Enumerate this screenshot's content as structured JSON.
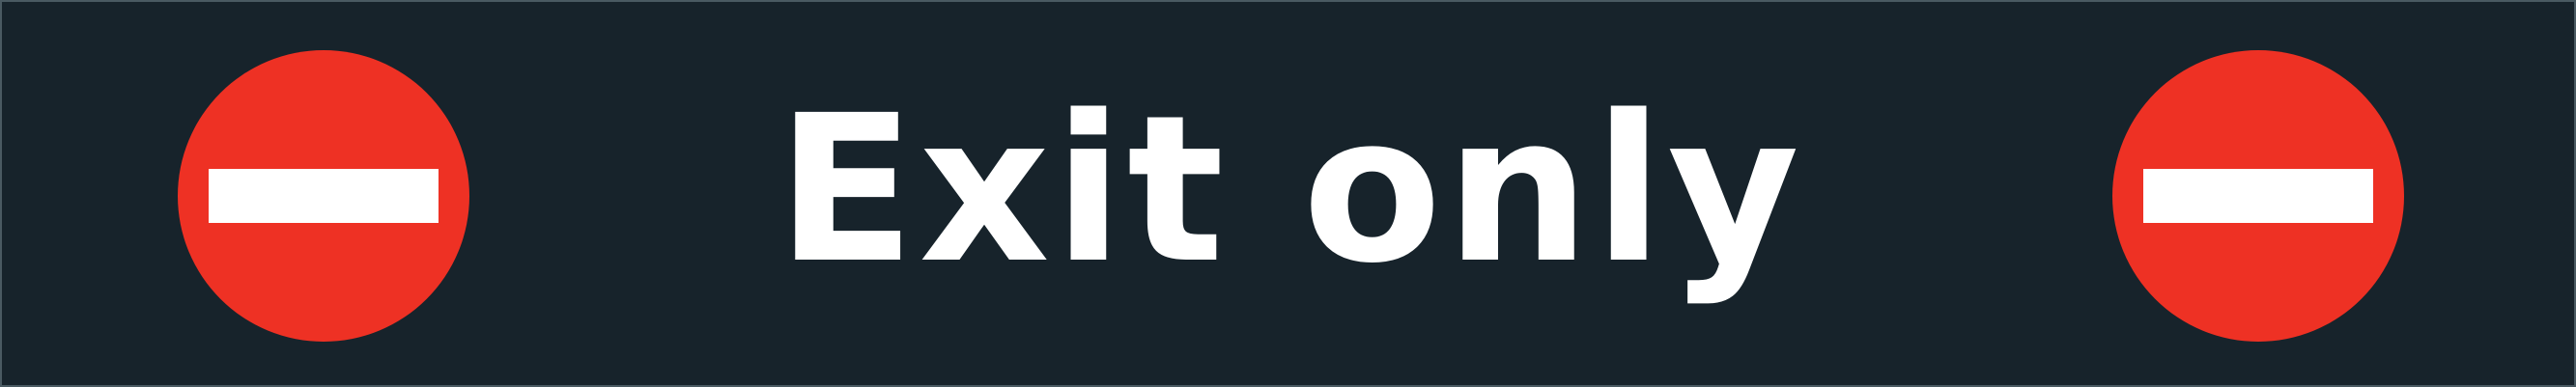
{
  "sign": {
    "text": "Exit only",
    "background_color": "#17232b",
    "text_color": "#ffffff",
    "symbols": [
      {
        "icon": "no-entry-icon",
        "disc_color": "#ee3124",
        "bar_color": "#ffffff"
      },
      {
        "icon": "no-entry-icon",
        "disc_color": "#ee3124",
        "bar_color": "#ffffff"
      }
    ]
  }
}
